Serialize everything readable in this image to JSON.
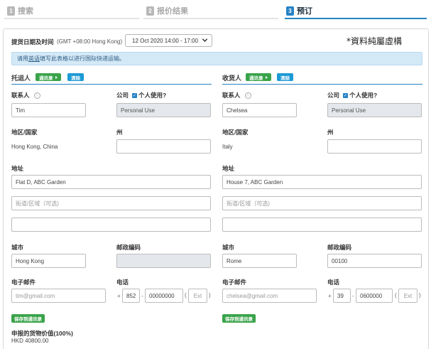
{
  "steps": [
    {
      "num": "1",
      "label": "搜索"
    },
    {
      "num": "2",
      "label": "报价结果"
    },
    {
      "num": "3",
      "label": "预订"
    }
  ],
  "pickup": {
    "label": "提货日期及时间",
    "timezone": "(GMT +08:00 Hong Kong)",
    "selected": "12 Oct 2020 14:00 - 17:00"
  },
  "watermark": "*資料純屬虛構",
  "notice": {
    "before": "请用",
    "link": "英语",
    "after": "填写此表格以进行国际快递运输。"
  },
  "labels": {
    "contact": "联系人",
    "company": "公司",
    "personal_use": "个人使用?",
    "region": "地区/国家",
    "state": "州",
    "address": "地址",
    "city": "城市",
    "postcode": "邮政编码",
    "email": "电子邮件",
    "phone": "电话",
    "address_placeholder": "街道/区域（可选)",
    "ext_placeholder": "Ext",
    "plus": "+",
    "dash": "-",
    "info": "i",
    "check": "✓"
  },
  "shipper": {
    "title": "托运人",
    "address_book": "通讯录",
    "clear": "清除",
    "contact": "Tim",
    "company": "Personal Use",
    "region": "Hong Kong, China",
    "state": "",
    "address1": "Flat D, ABC Garden",
    "address3": "",
    "city": "Hong Kong",
    "postcode": "",
    "email_placeholder": "tim@gmail.com",
    "phone_code": "852",
    "phone_number": "00000000",
    "save_label": "保存到通讯录"
  },
  "consignee": {
    "title": "收货人",
    "address_book": "通讯录",
    "clear": "清除",
    "contact": "Chelsea",
    "company": "Personal Use",
    "region": "Italy",
    "state": "",
    "address1": "House 7, ABC Garden",
    "address3": "",
    "city": "Rome",
    "postcode": "00100",
    "email_placeholder": "chelsea@gmail.com",
    "phone_code": "39",
    "phone_number": "0600000",
    "save_label": "保存到通讯录"
  },
  "declared": {
    "label": "申报的货物价值(100%)",
    "value": "HKD 40800.00"
  }
}
